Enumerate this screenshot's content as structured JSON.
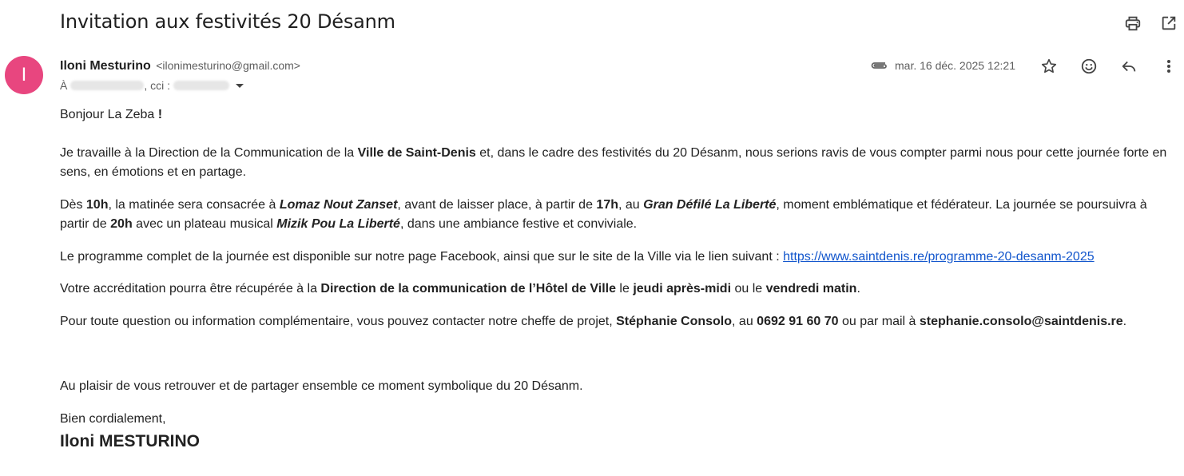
{
  "email": {
    "subject": "Invitation aux festivités 20 Désanm",
    "sender": {
      "initial": "I",
      "name": "Iloni Mesturino",
      "email": "<ilonimesturino@gmail.com>",
      "avatar_color": "#e8467f"
    },
    "recipients": {
      "to_label": "À",
      "cc_label": ", cci :"
    },
    "date": "mar. 16 déc. 2025 12:21",
    "has_attachment": true,
    "icons": [
      "print-icon",
      "open-in-new-window-icon",
      "paperclip-icon",
      "star-icon",
      "emoji-icon",
      "reply-icon",
      "more-vert-icon"
    ]
  },
  "body": {
    "greeting": {
      "text": "Bonjour La Zeba ",
      "bang": "!"
    },
    "p1": {
      "t1": "Je travaille à la Direction de la Communication de la ",
      "b1": "Ville de Saint-Denis",
      "t2": " et, dans le cadre des festivités du 20 Désanm, nous serions ravis de vous compter parmi nous pour cette journée forte en sens, en émotions et en partage."
    },
    "p2": {
      "t1": "Dès ",
      "b1": "10h",
      "t2": ", la matinée sera consacrée à ",
      "bi1": "Lomaz Nout Zanset",
      "t3": ", avant de laisser place, à partir de ",
      "b2": "17h",
      "t4": ", au ",
      "bi2": "Gran Défilé La Liberté",
      "t5": ", moment emblématique et fédérateur. La journée se poursuivra à partir de ",
      "b3": "20h",
      "t6": " avec un plateau musical ",
      "bi3": "Mizik Pou La Liberté",
      "t7": ", dans une ambiance festive et conviviale."
    },
    "p3": {
      "t1": "Le programme complet de la journée est disponible sur notre page Facebook, ainsi que sur le site de la Ville via le lien suivant : ",
      "link": "https://www.saintdenis.re/programme-20-desanm-2025"
    },
    "p4": {
      "t1": "Votre accréditation pourra être récupérée à la ",
      "b1": "Direction de la communication de l’Hôtel de Ville",
      "t2": " le ",
      "b2": "jeudi après-midi",
      "t3": " ou le ",
      "b3": "vendredi matin",
      "t4": "."
    },
    "p5": {
      "t1": "Pour toute question ou information complémentaire, vous pouvez contacter notre cheffe de projet, ",
      "b1": "Stéphanie Consolo",
      "t2": ", au ",
      "b2": "0692 91 60 70",
      "t3": " ou par mail à ",
      "b3": "stephanie.consolo@saintdenis.re",
      "t4": "."
    },
    "p6": "Au plaisir de vous retrouver et de partager ensemble ce moment symbolique du 20 Désanm.",
    "closing": "Bien cordialement,",
    "signature": "Iloni MESTURINO"
  }
}
